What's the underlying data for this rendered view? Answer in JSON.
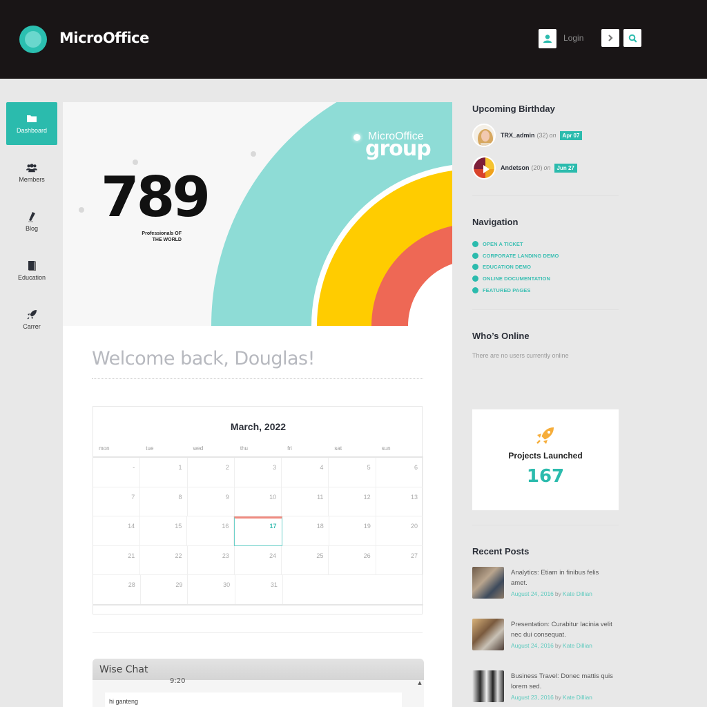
{
  "header": {
    "app_name": "MicroOffice",
    "login_label": "Login",
    "icons": {
      "login": "user-icon",
      "next": "chevron-right-icon",
      "search": "search-icon"
    }
  },
  "sidebar": {
    "items": [
      {
        "label": "Dashboard",
        "icon": "folder-icon",
        "active": true
      },
      {
        "label": "Members",
        "icon": "users-icon",
        "active": false
      },
      {
        "label": "Blog",
        "icon": "pencil-icon",
        "active": false
      },
      {
        "label": "Education",
        "icon": "book-icon",
        "active": false
      },
      {
        "label": "Carrer",
        "icon": "rocket-icon",
        "active": false
      }
    ]
  },
  "banner": {
    "number": "789",
    "subtitle_line1": "Professionals OF",
    "subtitle_line2": "THE WORLD",
    "brand_small": "MicroOffice",
    "brand_big": "group",
    "colors": {
      "teal": "#8edcd6",
      "yellow": "#ffcc00",
      "red": "#ee6855"
    }
  },
  "main": {
    "welcome": "Welcome back, Douglas!"
  },
  "calendar": {
    "title": "March, 2022",
    "weekdays": [
      "mon",
      "tue",
      "wed",
      "thu",
      "fri",
      "sat",
      "sun"
    ],
    "weeks": [
      [
        "-",
        "1",
        "2",
        "3",
        "4",
        "5",
        "6"
      ],
      [
        "7",
        "8",
        "9",
        "10",
        "11",
        "12",
        "13"
      ],
      [
        "14",
        "15",
        "16",
        "17",
        "18",
        "19",
        "20"
      ],
      [
        "21",
        "22",
        "23",
        "24",
        "25",
        "26",
        "27"
      ],
      [
        "28",
        "29",
        "30",
        "31",
        "",
        "",
        ""
      ]
    ],
    "today": "17"
  },
  "chat": {
    "title": "Wise Chat",
    "time": "9:20",
    "message": "hi ganteng"
  },
  "right": {
    "birthday_title": "Upcoming Birthday",
    "birthdays": [
      {
        "name": "TRX_admin",
        "age": "(32)",
        "on": "on",
        "date": "Apr 07"
      },
      {
        "name": "Andetson",
        "age": "(20)",
        "on": "on",
        "date": "Jun 27"
      }
    ],
    "navigation_title": "Navigation",
    "navigation": [
      "OPEN A TICKET",
      "CORPORATE LANDING DEMO",
      "EDUCATION DEMO",
      "ONLINE DOCUMENTATION",
      "FEATURED PAGES"
    ],
    "online_title": "Who’s Online",
    "online_text": "There are no users currently online",
    "stat": {
      "label": "Projects Launched",
      "value": "167",
      "icon": "rocket-icon"
    },
    "posts_title": "Recent Posts",
    "posts": [
      {
        "title": "Analytics: Etiam in finibus felis amet.",
        "date": "August 24, 2016",
        "by": "by",
        "author": "Kate Dillian"
      },
      {
        "title": "Presentation: Curabitur lacinia velit nec dui consequat.",
        "date": "August 24, 2016",
        "by": "by",
        "author": "Kate Dillian"
      },
      {
        "title": "Business Travel: Donec mattis quis lorem sed.",
        "date": "August 23, 2016",
        "by": "by",
        "author": "Kate Dillian"
      }
    ]
  },
  "colors": {
    "accent": "#2bbbad",
    "header_bg": "#191516",
    "page_bg": "#e8e8e8"
  }
}
